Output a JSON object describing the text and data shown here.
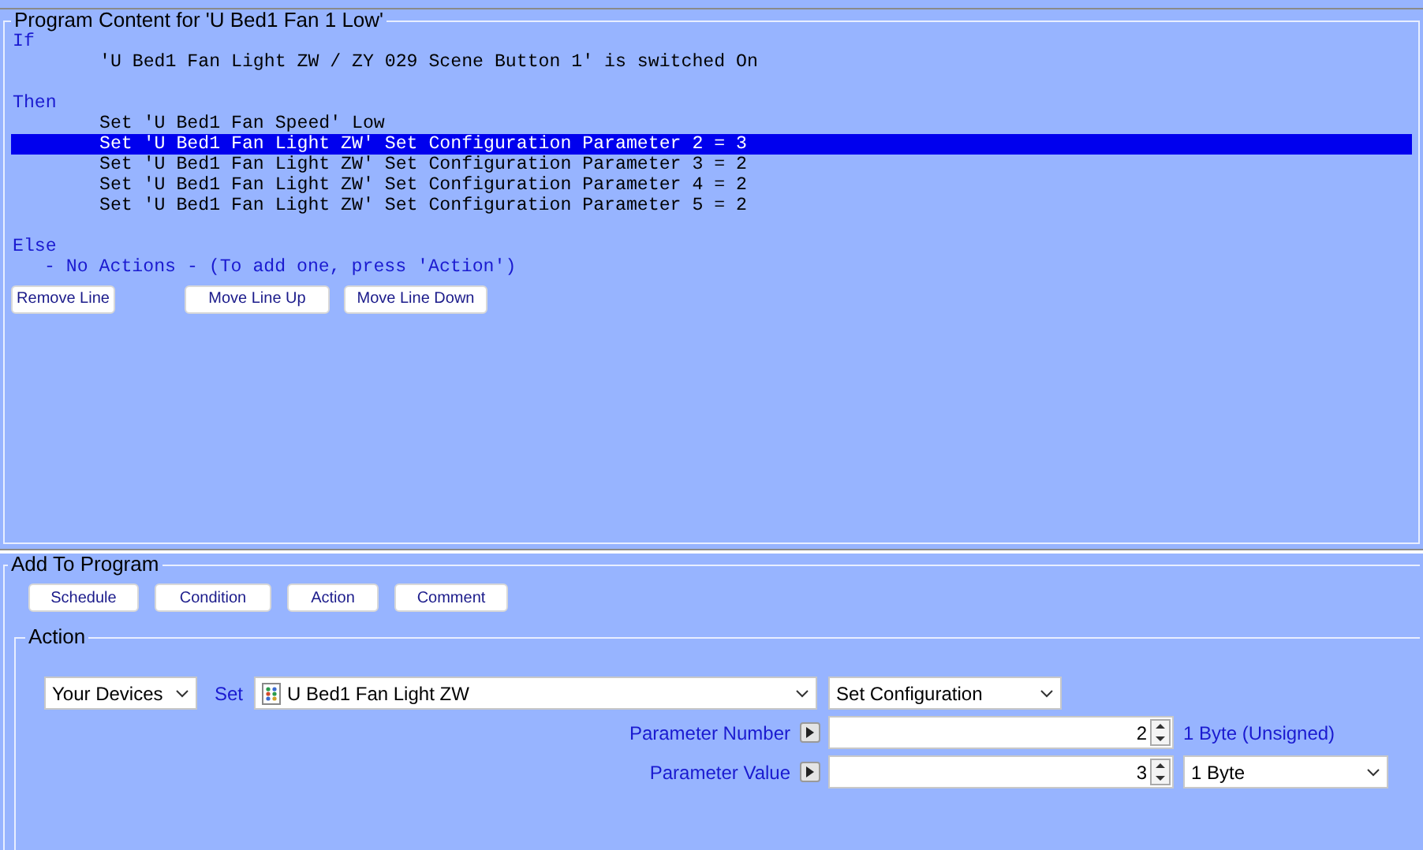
{
  "program_content": {
    "title": "Program Content for 'U Bed1 Fan 1 Low'",
    "sections": [
      {
        "keyword": "If",
        "lines": [
          {
            "text": "'U Bed1 Fan Light ZW / ZY 029 Scene Button 1' is switched On",
            "kind": "statement",
            "selected": false
          }
        ]
      },
      {
        "keyword": "Then",
        "lines": [
          {
            "text": "Set 'U Bed1 Fan Speed' Low",
            "kind": "statement",
            "selected": false
          },
          {
            "text": "Set 'U Bed1 Fan Light ZW' Set Configuration Parameter 2 = 3",
            "kind": "statement",
            "selected": true
          },
          {
            "text": "Set 'U Bed1 Fan Light ZW' Set Configuration Parameter 3 = 2",
            "kind": "statement",
            "selected": false
          },
          {
            "text": "Set 'U Bed1 Fan Light ZW' Set Configuration Parameter 4 = 2",
            "kind": "statement",
            "selected": false
          },
          {
            "text": "Set 'U Bed1 Fan Light ZW' Set Configuration Parameter 5 = 2",
            "kind": "statement",
            "selected": false
          }
        ]
      },
      {
        "keyword": "Else",
        "lines": [
          {
            "text": "- No Actions - (To add one, press 'Action')",
            "kind": "note",
            "selected": false
          }
        ]
      }
    ],
    "buttons": [
      "Remove Line",
      "Move Line Up",
      "Move Line Down"
    ]
  },
  "add_to_program": {
    "title": "Add To Program",
    "buttons": [
      "Schedule",
      "Condition",
      "Action",
      "Comment"
    ],
    "action": {
      "title": "Action",
      "source": "Your Devices",
      "set_label": "Set",
      "device": "U Bed1 Fan Light ZW",
      "command": "Set Configuration",
      "parameters": [
        {
          "label": "Parameter Number",
          "value": "2",
          "kind": "text",
          "suffix": "1 Byte (Unsigned)"
        },
        {
          "label": "Parameter Value",
          "value": "3",
          "kind": "select",
          "suffix": "1 Byte"
        }
      ]
    }
  }
}
